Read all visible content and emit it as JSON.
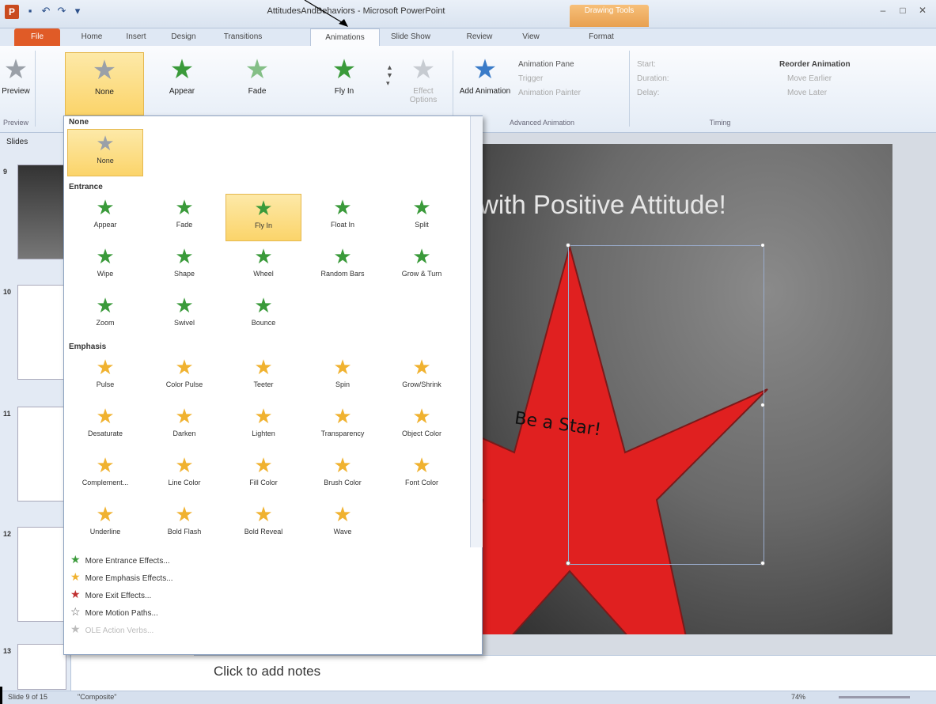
{
  "title_bar": {
    "title": "AttitudesAndBehaviors - Microsoft PowerPoint",
    "context_tab": "Drawing Tools",
    "app_icon": "P"
  },
  "tabs": [
    "File",
    "Home",
    "Insert",
    "Design",
    "Transitions",
    "Animations",
    "Slide Show",
    "Review",
    "View",
    "Format"
  ],
  "ribbon": {
    "preview_label": "Preview",
    "preview_group": "Preview",
    "gallery_items": [
      "None",
      "Appear",
      "Fade",
      "Fly In"
    ],
    "effect_options": "Effect Options",
    "add_animation": "Add Animation",
    "animation_pane": "Animation Pane",
    "trigger": "Trigger",
    "animation_painter": "Animation Painter",
    "advanced_group": "Advanced Animation",
    "start": "Start:",
    "duration": "Duration:",
    "delay": "Delay:",
    "timing_group": "Timing",
    "reorder": "Reorder Animation",
    "move_earlier": "Move Earlier",
    "move_later": "Move Later"
  },
  "slides_pane": {
    "tab_label": "Slides",
    "numbers": [
      "9",
      "10",
      "11",
      "12",
      "13"
    ]
  },
  "slide": {
    "title": "with Positive Attitude!",
    "star_text": "Be a Star!"
  },
  "gallery": {
    "none_header": "None",
    "none_item": "None",
    "entrance_header": "Entrance",
    "entrance": [
      "Appear",
      "Fade",
      "Fly In",
      "Float In",
      "Split",
      "Wipe",
      "Shape",
      "Wheel",
      "Random Bars",
      "Grow & Turn",
      "Zoom",
      "Swivel",
      "Bounce"
    ],
    "emphasis_header": "Emphasis",
    "emphasis": [
      "Pulse",
      "Color Pulse",
      "Teeter",
      "Spin",
      "Grow/Shrink",
      "Desaturate",
      "Darken",
      "Lighten",
      "Transparency",
      "Object Color",
      "Complement...",
      "Line Color",
      "Fill Color",
      "Brush Color",
      "Font Color",
      "Underline",
      "Bold Flash",
      "Bold Reveal",
      "Wave"
    ],
    "more_links": [
      "More Entrance Effects...",
      "More Emphasis Effects...",
      "More Exit Effects...",
      "More Motion Paths...",
      "OLE Action Verbs..."
    ]
  },
  "notes_placeholder": "Click to add notes",
  "status_bar": {
    "slide_info": "Slide 9 of 15",
    "theme": "\"Composite\"",
    "zoom": "74%"
  },
  "colors": {
    "accent_orange": "#e05b27",
    "selection_gold": "#fbd46a",
    "star_red": "#e02020"
  }
}
